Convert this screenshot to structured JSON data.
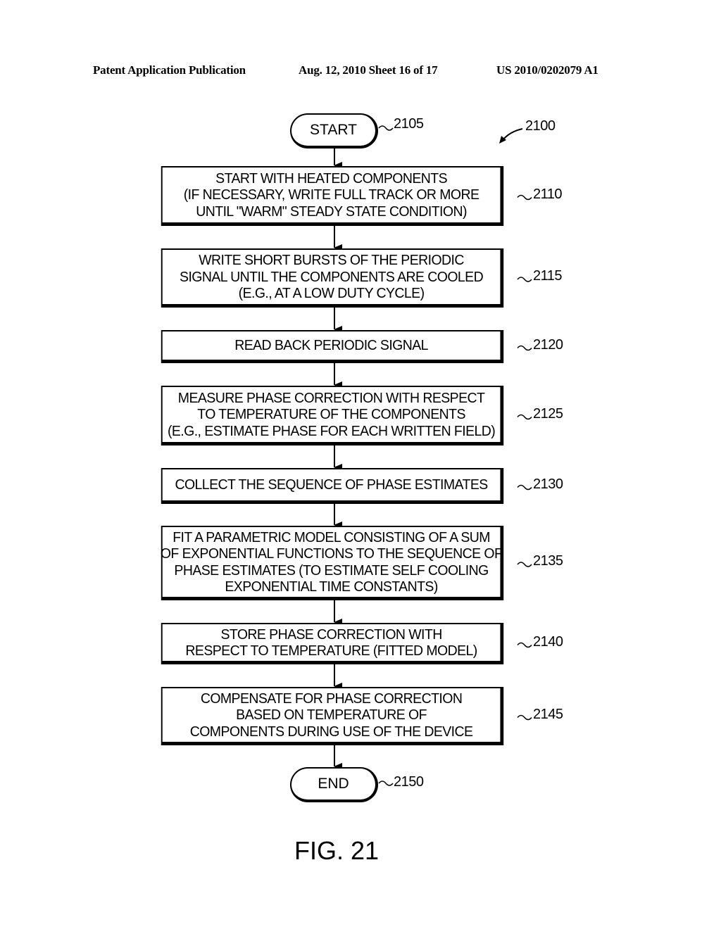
{
  "header": {
    "publication": "Patent Application Publication",
    "date_sheet": "Aug. 12, 2010  Sheet 16 of 17",
    "patent_number": "US 2010/0202079 A1"
  },
  "diagram": {
    "figure_label": "FIG. 21",
    "figure_ref": "2100",
    "start": {
      "label": "START",
      "ref": "2105"
    },
    "end": {
      "label": "END",
      "ref": "2150"
    },
    "steps": [
      {
        "ref": "2110",
        "lines": [
          "START WITH HEATED COMPONENTS",
          "(IF NECESSARY, WRITE FULL TRACK OR MORE",
          "UNTIL \"WARM\" STEADY STATE CONDITION)"
        ]
      },
      {
        "ref": "2115",
        "lines": [
          "WRITE SHORT BURSTS OF THE PERIODIC",
          "SIGNAL UNTIL THE COMPONENTS ARE COOLED",
          "(E.G., AT A LOW DUTY CYCLE)"
        ]
      },
      {
        "ref": "2120",
        "lines": [
          "READ BACK PERIODIC SIGNAL"
        ]
      },
      {
        "ref": "2125",
        "lines": [
          "MEASURE PHASE CORRECTION WITH RESPECT",
          "TO TEMPERATURE OF THE COMPONENTS",
          "(E.G., ESTIMATE PHASE FOR EACH WRITTEN FIELD)"
        ]
      },
      {
        "ref": "2130",
        "lines": [
          "COLLECT THE SEQUENCE OF PHASE ESTIMATES"
        ]
      },
      {
        "ref": "2135",
        "lines": [
          "FIT A PARAMETRIC MODEL CONSISTING OF A SUM",
          "OF EXPONENTIAL FUNCTIONS TO THE SEQUENCE OF",
          "PHASE ESTIMATES (TO ESTIMATE SELF COOLING",
          "EXPONENTIAL TIME CONSTANTS)"
        ]
      },
      {
        "ref": "2140",
        "lines": [
          "STORE PHASE CORRECTION WITH",
          "RESPECT TO TEMPERATURE (FITTED MODEL)"
        ]
      },
      {
        "ref": "2145",
        "lines": [
          "COMPENSATE FOR PHASE CORRECTION",
          "BASED ON TEMPERATURE OF",
          "COMPONENTS DURING USE OF THE DEVICE"
        ]
      }
    ]
  }
}
